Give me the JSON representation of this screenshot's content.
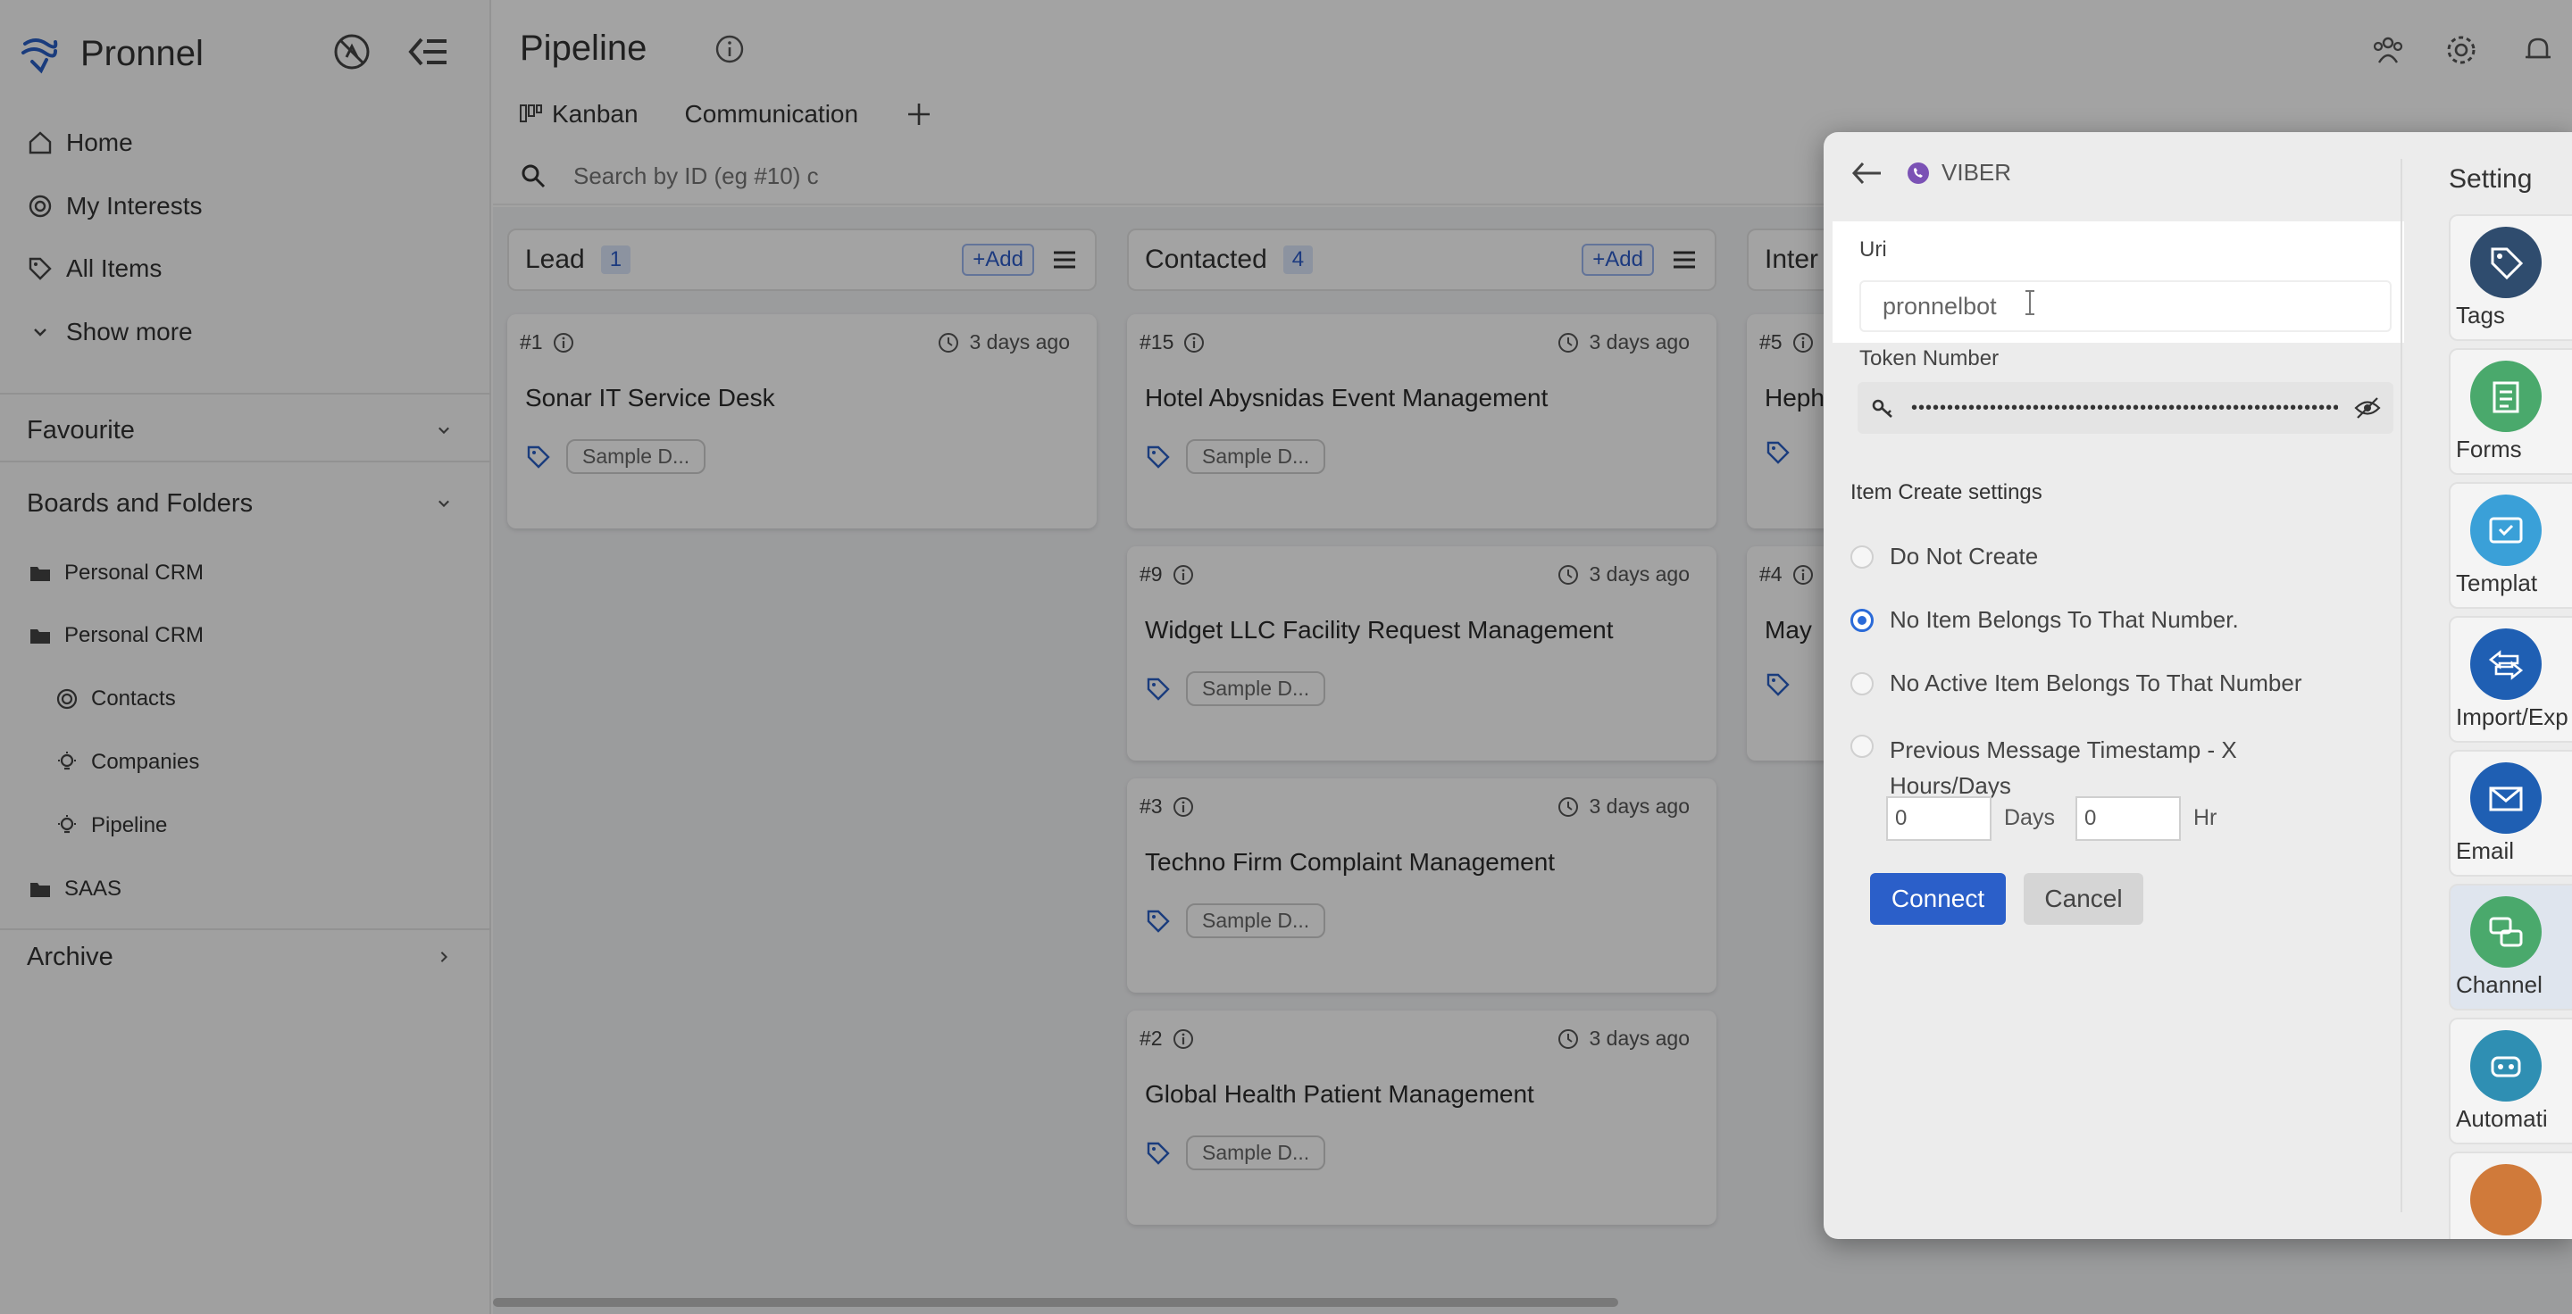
{
  "app": {
    "name": "Pronnel"
  },
  "sidebar": {
    "nav": [
      {
        "label": "Home",
        "icon": "home-icon"
      },
      {
        "label": "My Interests",
        "icon": "target-icon"
      },
      {
        "label": "All Items",
        "icon": "tag-icon"
      },
      {
        "label": "Show more",
        "icon": "chevron-down-icon"
      }
    ],
    "favourite": "Favourite",
    "boards_and_folders": "Boards and Folders",
    "tree": [
      {
        "label": "Personal CRM",
        "icon": "folder-icon"
      },
      {
        "label": "Personal CRM",
        "icon": "folder-icon"
      },
      {
        "label": "Contacts",
        "icon": "target-icon"
      },
      {
        "label": "Companies",
        "icon": "bulb-icon"
      },
      {
        "label": "Pipeline",
        "icon": "bulb-icon"
      },
      {
        "label": "SAAS",
        "icon": "folder-icon"
      }
    ],
    "archive": "Archive"
  },
  "header": {
    "title": "Pipeline",
    "tabs": [
      "Kanban",
      "Communication"
    ],
    "search_placeholder": "Search by ID (eg #10) c"
  },
  "board": {
    "columns": [
      {
        "name": "Lead",
        "count": "1",
        "add_label": "+Add",
        "cards": [
          {
            "id": "#1",
            "time": "3 days ago",
            "title": "Sonar IT Service Desk",
            "tag": "Sample D..."
          }
        ]
      },
      {
        "name": "Contacted",
        "count": "4",
        "add_label": "+Add",
        "cards": [
          {
            "id": "#15",
            "time": "3 days ago",
            "title": "Hotel Abysnidas Event Management",
            "tag": "Sample D..."
          },
          {
            "id": "#9",
            "time": "3 days ago",
            "title": "Widget LLC Facility Request Management",
            "tag": "Sample D..."
          },
          {
            "id": "#3",
            "time": "3 days ago",
            "title": "Techno Firm Complaint Management",
            "tag": "Sample D..."
          },
          {
            "id": "#2",
            "time": "3 days ago",
            "title": "Global Health Patient Management",
            "tag": "Sample D..."
          }
        ]
      },
      {
        "name": "Inter",
        "count": "",
        "add_label": "",
        "cards": [
          {
            "id": "#5",
            "time": "",
            "title": "Heph",
            "tag": ""
          },
          {
            "id": "#4",
            "time": "",
            "title": "May",
            "tag": ""
          }
        ]
      }
    ]
  },
  "modal": {
    "channel": "VIBER",
    "uri_label": "Uri",
    "uri_value": "pronnelbot",
    "token_label": "Token Number",
    "token_value": "•••••••••••••••••••••••••••••••••••••••••••••••••••••••••••••••",
    "item_create_title": "Item Create settings",
    "options": [
      {
        "label": "Do Not Create",
        "checked": false
      },
      {
        "label": "No Item Belongs To That Number.",
        "checked": true
      },
      {
        "label": "No Active Item Belongs To That Number",
        "checked": false
      },
      {
        "label": "Previous Message Timestamp - X Hours/Days",
        "checked": false
      }
    ],
    "days_value": "0",
    "days_label": "Days",
    "hours_value": "0",
    "hours_label": "Hr",
    "connect_label": "Connect",
    "cancel_label": "Cancel",
    "settings_title": "Setting",
    "tiles": [
      {
        "label": "Tags",
        "icon": "tag-icon",
        "color": "#2f4c6e"
      },
      {
        "label": "Forms",
        "icon": "form-icon",
        "color": "#4aa96c"
      },
      {
        "label": "Templat",
        "icon": "template-icon",
        "color": "#3aa0d8"
      },
      {
        "label": "Import/Exp",
        "icon": "import-export-icon",
        "color": "#1f5fb3"
      },
      {
        "label": "Email",
        "icon": "email-icon",
        "color": "#1f5fb3"
      },
      {
        "label": "Channel",
        "icon": "channel-icon",
        "color": "#4aa96c"
      },
      {
        "label": "Automati",
        "icon": "automation-icon",
        "color": "#2f8fb3"
      }
    ]
  }
}
